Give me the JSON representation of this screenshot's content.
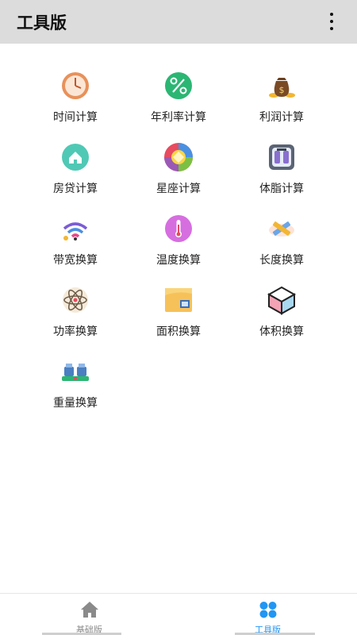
{
  "header": {
    "title": "工具版",
    "more_icon": "more-vertical-icon"
  },
  "tools": [
    {
      "label": "时间计算",
      "icon": "clock-icon"
    },
    {
      "label": "年利率计算",
      "icon": "percent-icon"
    },
    {
      "label": "利润计算",
      "icon": "money-bag-icon"
    },
    {
      "label": "房贷计算",
      "icon": "house-icon"
    },
    {
      "label": "星座计算",
      "icon": "zodiac-wheel-icon"
    },
    {
      "label": "体脂计算",
      "icon": "body-scale-icon"
    },
    {
      "label": "带宽换算",
      "icon": "wifi-signal-icon"
    },
    {
      "label": "温度换算",
      "icon": "thermometer-icon"
    },
    {
      "label": "长度换算",
      "icon": "ruler-icon"
    },
    {
      "label": "功率换算",
      "icon": "atom-icon"
    },
    {
      "label": "面积换算",
      "icon": "area-map-icon"
    },
    {
      "label": "体积换算",
      "icon": "cube-icon"
    },
    {
      "label": "重量换算",
      "icon": "weight-scale-icon"
    }
  ],
  "bottom_nav": {
    "items": [
      {
        "label": "基础版",
        "icon": "home-icon",
        "active": false
      },
      {
        "label": "工具版",
        "icon": "grid-dots-icon",
        "active": true
      }
    ],
    "active_color": "#2196f3",
    "inactive_color": "#8a8a8a"
  },
  "colors": {
    "header_bg": "#dcdcdc",
    "accent": "#2196f3"
  }
}
